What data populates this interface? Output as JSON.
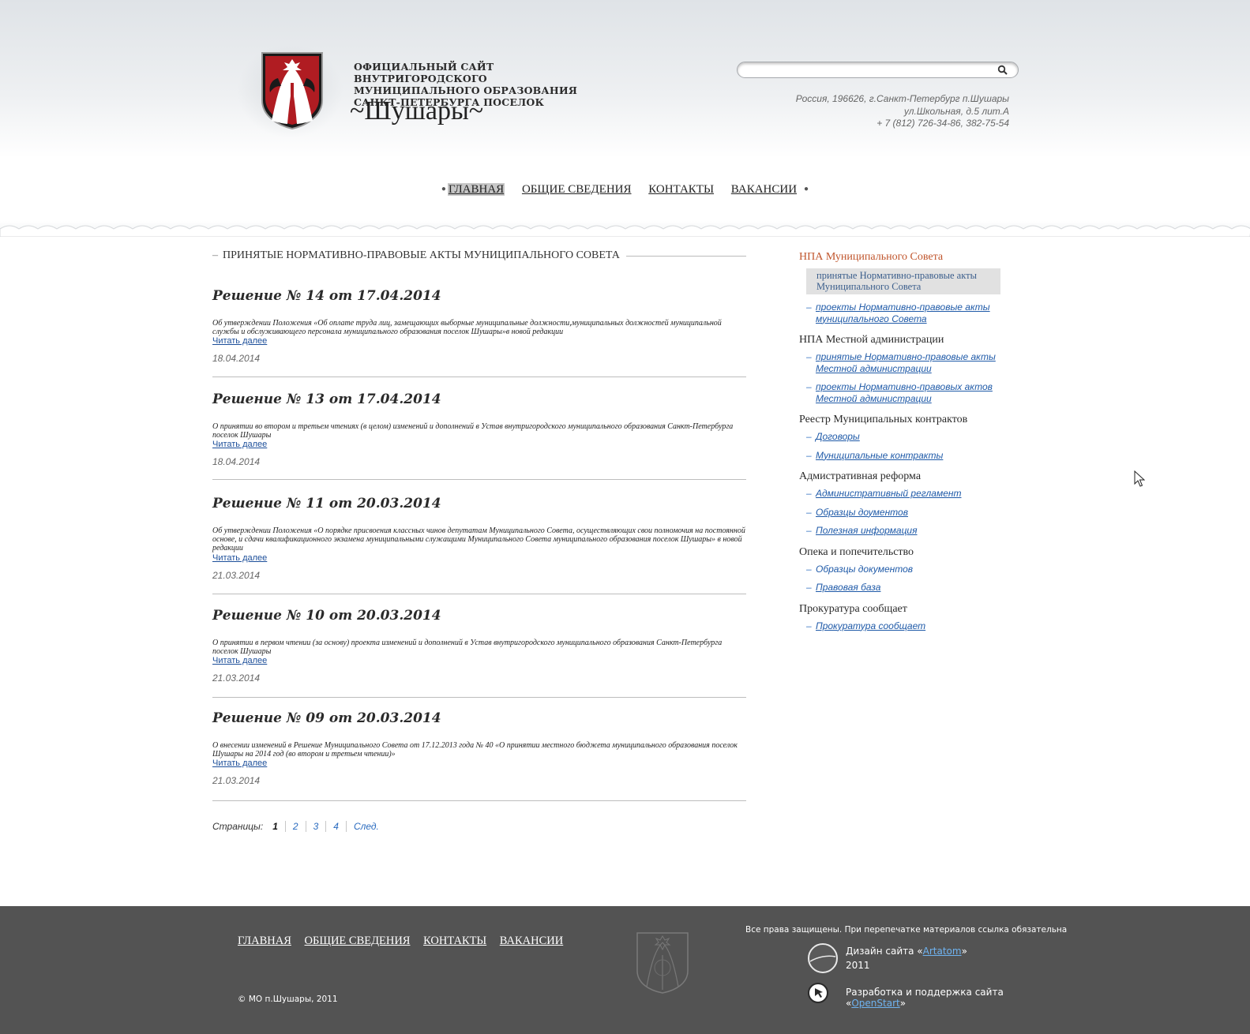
{
  "header": {
    "site_title": "Официальный сайт внутригородского муниципального образования Санкт-Петербурга поселок",
    "site_name": "~Шушары~",
    "search": {
      "placeholder": "",
      "value": ""
    },
    "address": {
      "line1": "Россия, 196626, г.Санкт-Петербург п.Шушары",
      "line2": "ул.Школьная, д.5 лит.А",
      "line3": "+ 7 (812) 726-34-86, 382-75-54"
    }
  },
  "nav": {
    "items": [
      {
        "label": "ГЛАВНАЯ"
      },
      {
        "label": "ОБЩИЕ СВЕДЕНИЯ"
      },
      {
        "label": "КОНТАКТЫ"
      },
      {
        "label": "ВАКАНСИИ"
      }
    ]
  },
  "main": {
    "section_title": "ПРИНЯТЫЕ НОРМАТИВНО-ПРАВОВЫЕ АКТЫ МУНИЦИПАЛЬНОГО СОВЕТА",
    "read_more": "Читать далее",
    "articles": [
      {
        "title": "Решение № 14 от 17.04.2014",
        "desc": "Об утверждении Положения «Об оплате труда лиц, замещающих выборные муниципальные должности,муниципальных должностей муниципальной службы и обслуживающего персонала муниципального образования поселок Шушары»в новой редакции",
        "date": "18.04.2014"
      },
      {
        "title": "Решение № 13 от 17.04.2014",
        "desc": "О принятии во втором и  третьем чтениях (в целом) изменений и дополнений в Устав внутригородского муниципального образования Санкт-Петербурга поселок Шушары",
        "date": "18.04.2014"
      },
      {
        "title": "Решение № 11 от 20.03.2014",
        "desc": "Об утверждении Положения «О порядке присвоения классных чинов депутатам Муниципального Совета, осуществляющих свои полномочия на постоянной основе, и сдачи квалификационного экзамена муниципальными служащими Муниципального Совета муниципального образования поселок Шушары» в новой редакции",
        "date": "21.03.2014"
      },
      {
        "title": "Решение № 10 от 20.03.2014",
        "desc": "О принятии в первом чтении (за основу) проекта изменений и дополнений в Устав внутригородского муниципального образования Санкт-Петербурга поселок Шушары",
        "date": "21.03.2014"
      },
      {
        "title": "Решение № 09 от 20.03.2014",
        "desc": "О внесении изменений в Решение Муниципального Совета от 17.12.2013 года № 40 «О принятии местного бюджета муниципального образования поселок Шушары на 2014 год (во втором и третьем чтении)»",
        "date": "21.03.2014"
      }
    ],
    "pager": {
      "label": "Страницы:",
      "pages": [
        "1",
        "2",
        "3",
        "4"
      ],
      "next": "След."
    }
  },
  "sidebar": {
    "group1": {
      "title": "НПА Муниципального Совета",
      "active": "принятые Нормативно-правовые акты Муниципального Совета",
      "dash": "–",
      "links": [
        "проекты Нормативно-правовые акты муниципального Совета"
      ]
    },
    "group2": {
      "title": "НПА Местной администрации",
      "links": [
        "принятые Нормативно-правовые акты Местной администрации",
        "проекты Нормативно-правовых актов Местной администрации"
      ]
    },
    "group3": {
      "title": "Реестр Муниципальных контрактов",
      "links": [
        "Договоры",
        "Муниципальные контракты"
      ]
    },
    "group4": {
      "title": "Адмистративная реформа",
      "links": [
        "Административный регламент",
        "Образцы доументов",
        "Полезная информация"
      ]
    },
    "group5": {
      "title": "Опека и попечительство",
      "links": [
        "Образцы документов",
        "Правовая база"
      ]
    },
    "group6": {
      "title": "Прокуратура сообщает",
      "links": [
        "Прокуратура сообщает"
      ]
    }
  },
  "footer": {
    "nav": [
      "ГЛАВНАЯ",
      "ОБЩИЕ СВЕДЕНИЯ",
      "КОНТАКТЫ",
      "ВАКАНСИИ"
    ],
    "copyright": "©  МО п.Шушары, 2011",
    "rights": "Все права защищены. При перепечатке материалов ссылка обязательна",
    "design_prefix": "Дизайн сайта «",
    "design_link": "Artatom",
    "design_suffix": "»",
    "design_year": "2011",
    "dev_prefix": "Разработка и поддержка сайта «",
    "dev_link": "OpenStart",
    "dev_suffix": "»"
  },
  "colors": {
    "accent_red": "#c0552c",
    "link_blue": "#1f5aa8",
    "footer_bg": "#535353",
    "emblem_red": "#b01c22"
  },
  "icons": {
    "search": "magnifier-icon",
    "emblem": "coat-of-arms-icon",
    "cursor": "mouse-pointer-icon"
  }
}
